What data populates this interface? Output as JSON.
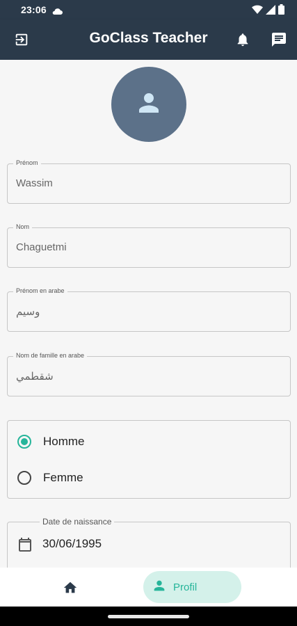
{
  "status_bar": {
    "time": "23:06",
    "icons": [
      "cloud-icon",
      "wifi-icon",
      "signal-icon",
      "battery-icon"
    ]
  },
  "app_bar": {
    "title": "GoClass Teacher",
    "left_icon": "logout-icon",
    "right_icons": [
      "bell-icon",
      "message-icon"
    ]
  },
  "profile": {
    "avatar_icon": "person-icon",
    "fields": [
      {
        "label": "Prénom",
        "value": "Wassim"
      },
      {
        "label": "Nom",
        "value": "Chaguetmi"
      },
      {
        "label": "Prénom en arabe",
        "value": "وسيم"
      },
      {
        "label": "Nom de famille en arabe",
        "value": "شقطمي"
      }
    ],
    "gender": {
      "options": [
        "Homme",
        "Femme"
      ],
      "selected": "Homme"
    },
    "birth_date": {
      "label": "Date de naissance",
      "value": "30/06/1995",
      "icon": "calendar-icon"
    }
  },
  "bottom_nav": {
    "items": [
      {
        "icon": "home-icon",
        "label": ""
      },
      {
        "icon": "person-icon",
        "label": "Profil",
        "active": true
      }
    ]
  },
  "colors": {
    "app_bar": "#2b3a4a",
    "accent": "#26b59a",
    "accent_bg": "#d4f1ea",
    "avatar": "#5c7189"
  }
}
